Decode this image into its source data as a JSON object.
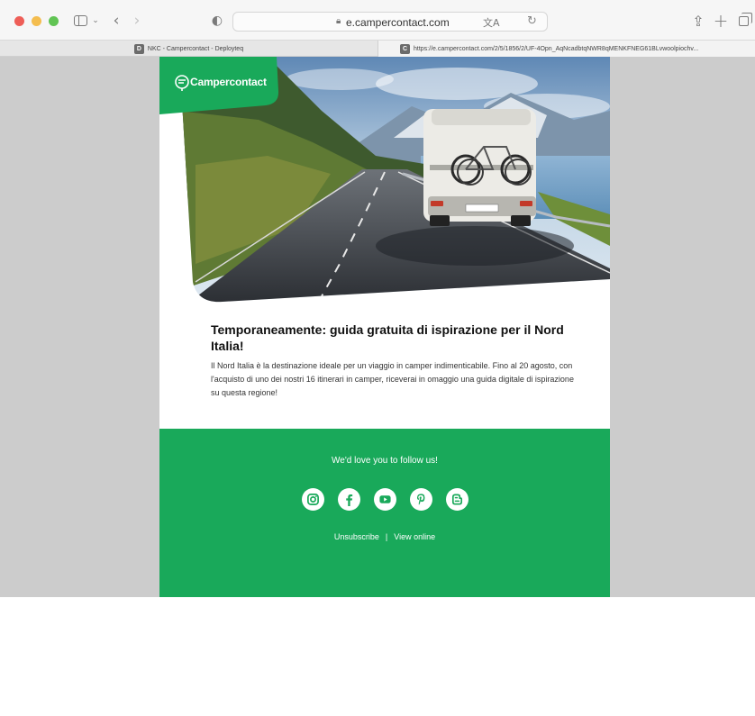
{
  "browser": {
    "url_host": "e.campercontact.com",
    "tabs": [
      {
        "favicon": "D",
        "label": "NKC - Campercontact - Deployteq"
      },
      {
        "favicon": "C",
        "label": "https://e.campercontact.com/2/5/1856/2/UF-4Opn_AqNcadbtqNWR8qMENKFNEG61BLvwoolpiochv..."
      }
    ]
  },
  "email": {
    "brand": "Campercontact",
    "title": "Temporaneamente: guida gratuita di ispirazione per il Nord Italia!",
    "body": "Il Nord Italia è la destinazione ideale per un viaggio in camper indimenticabile. Fino al 20 agosto, con l'acquisto di uno dei nostri 16 itinerari in camper, riceverai in omaggio una guida digitale di ispirazione su questa regione!",
    "footer": {
      "follow_text": "We'd love you to follow us!",
      "socials": [
        "instagram-icon",
        "facebook-icon",
        "youtube-icon",
        "pinterest-icon",
        "blogger-icon"
      ],
      "unsubscribe": "Unsubscribe",
      "separator": "|",
      "view_online": "View online"
    }
  },
  "colors": {
    "brand_green": "#19a95a",
    "page_gray": "#cccccc"
  }
}
